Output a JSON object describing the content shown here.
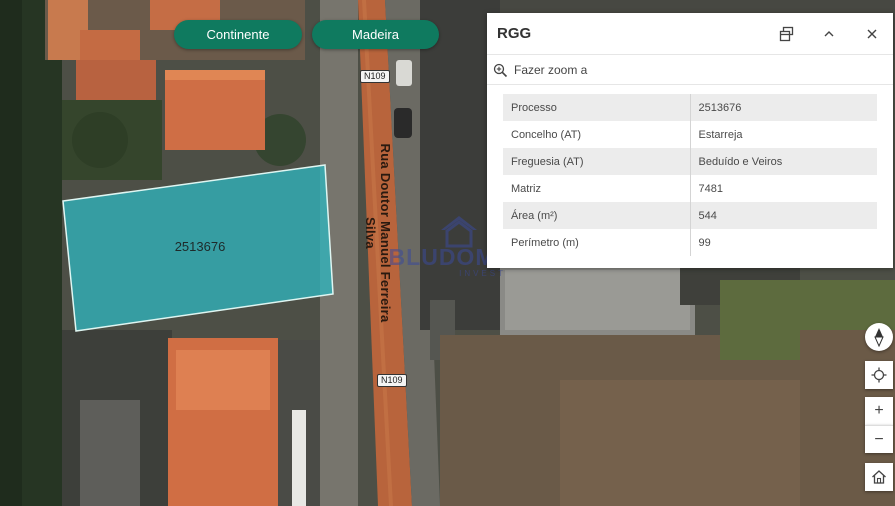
{
  "region_buttons": {
    "continente": "Continente",
    "madeira": "Madeira"
  },
  "map": {
    "parcel_label": "2513676",
    "road_name": "Rua Doutor Manuel Ferreira Silva",
    "road_shield": "N109",
    "watermark": {
      "brand": "BLUDOMUS",
      "tagline": "INVEST"
    },
    "parcel_fill": "#2fb3bd"
  },
  "popup": {
    "title": "RGG",
    "icons": {
      "dock": "dock-icon",
      "collapse": "chevron-up-icon",
      "close": "close-icon"
    },
    "zoom_label": "Fazer zoom a",
    "attributes": [
      {
        "key": "Processo",
        "value": "2513676"
      },
      {
        "key": "Concelho (AT)",
        "value": "Estarreja"
      },
      {
        "key": "Freguesia (AT)",
        "value": "Beduído e Veiros"
      },
      {
        "key": "Matriz",
        "value": "7481"
      },
      {
        "key": "Área (m²)",
        "value": "544"
      },
      {
        "key": "Perímetro (m)",
        "value": "99"
      }
    ]
  },
  "controls": {
    "zoom_in": "+",
    "zoom_out": "−",
    "icons": [
      "compass-icon",
      "locate-icon",
      "home-icon"
    ]
  },
  "colors": {
    "button": "#0f7a5f",
    "road": "#b8643c"
  }
}
